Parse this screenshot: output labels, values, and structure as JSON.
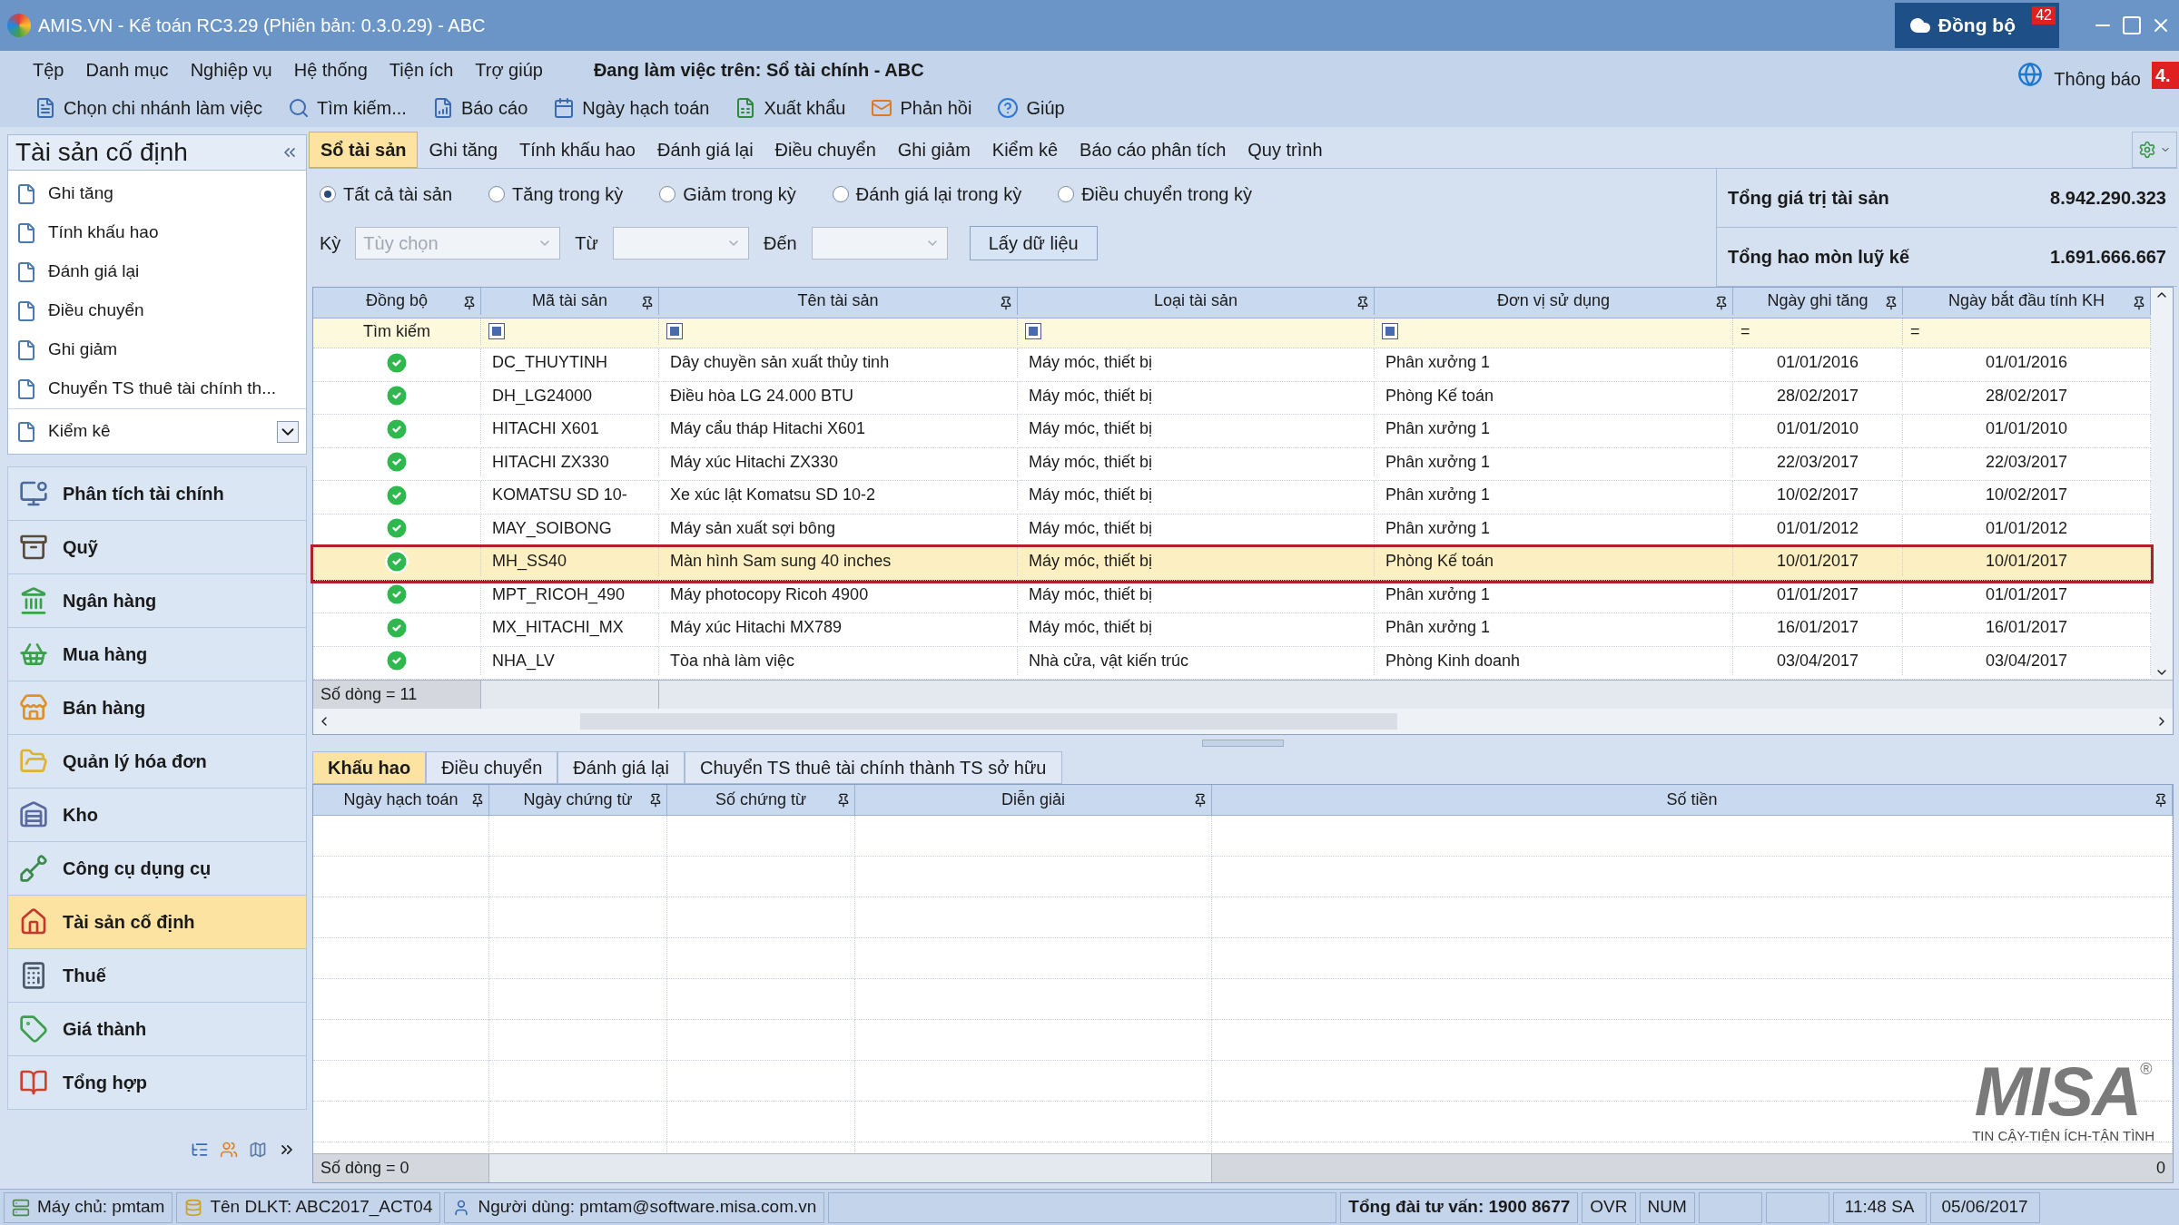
{
  "window": {
    "title": "AMIS.VN - Kế toán RC3.29 (Phiên bản: 0.3.0.29) - ABC",
    "sync_button": {
      "label": "Đồng bộ",
      "badge": "42"
    }
  },
  "menu": {
    "items": [
      "Tệp",
      "Danh mục",
      "Nghiệp vụ",
      "Hệ thống",
      "Tiện ích",
      "Trợ giúp"
    ],
    "working_on": "Đang làm việc trên: Sổ tài chính - ABC",
    "notification": {
      "label": "Thông báo",
      "badge": "4."
    }
  },
  "toolbar": [
    "Chọn chi nhánh làm việc",
    "Tìm kiếm...",
    "Báo cáo",
    "Ngày hạch toán",
    "Xuất khẩu",
    "Phản hồi",
    "Giúp"
  ],
  "sidebar": {
    "title": "Tài sản cố định",
    "items": [
      "Ghi tăng",
      "Tính khấu hao",
      "Đánh giá lại",
      "Điều chuyển",
      "Ghi giảm",
      "Chuyển TS thuê tài chính th..."
    ],
    "more_item": "Kiểm kê",
    "modules": [
      {
        "label": "Phân tích tài chính",
        "selected": false
      },
      {
        "label": "Quỹ",
        "selected": false
      },
      {
        "label": "Ngân hàng",
        "selected": false
      },
      {
        "label": "Mua hàng",
        "selected": false
      },
      {
        "label": "Bán hàng",
        "selected": false
      },
      {
        "label": "Quản lý hóa đơn",
        "selected": false
      },
      {
        "label": "Kho",
        "selected": false
      },
      {
        "label": "Công cụ dụng cụ",
        "selected": false
      },
      {
        "label": "Tài sản cố định",
        "selected": true
      },
      {
        "label": "Thuế",
        "selected": false
      },
      {
        "label": "Giá thành",
        "selected": false
      },
      {
        "label": "Tổng hợp",
        "selected": false
      }
    ]
  },
  "tabs": [
    {
      "label": "Sổ tài sản",
      "selected": true
    },
    {
      "label": "Ghi tăng",
      "selected": false
    },
    {
      "label": "Tính khấu hao",
      "selected": false
    },
    {
      "label": "Đánh giá lại",
      "selected": false
    },
    {
      "label": "Điều chuyển",
      "selected": false
    },
    {
      "label": "Ghi giảm",
      "selected": false
    },
    {
      "label": "Kiểm kê",
      "selected": false
    },
    {
      "label": "Báo cáo phân tích",
      "selected": false
    },
    {
      "label": "Quy trình",
      "selected": false
    }
  ],
  "filters": {
    "radios": [
      {
        "label": "Tất cả tài sản",
        "selected": true
      },
      {
        "label": "Tăng trong kỳ",
        "selected": false
      },
      {
        "label": "Giảm trong kỳ",
        "selected": false
      },
      {
        "label": "Đánh giá lại trong kỳ",
        "selected": false
      },
      {
        "label": "Điều chuyển trong kỳ",
        "selected": false
      }
    ],
    "period_label": "Kỳ",
    "period_value": "Tùy chọn",
    "from_label": "Từ",
    "to_label": "Đến",
    "fetch_button": "Lấy dữ liệu"
  },
  "summary": [
    {
      "label": "Tổng giá trị tài sản",
      "value": "8.942.290.323"
    },
    {
      "label": "Tổng hao mòn luỹ kế",
      "value": "1.691.666.667"
    }
  ],
  "asset_grid": {
    "columns": [
      {
        "label": "Đồng bộ",
        "kind": "status"
      },
      {
        "label": "Mã tài sản",
        "kind": "text"
      },
      {
        "label": "Tên tài sản",
        "kind": "text"
      },
      {
        "label": "Loại tài sản",
        "kind": "text"
      },
      {
        "label": "Đơn vị sử dụng",
        "kind": "text"
      },
      {
        "label": "Ngày ghi tăng",
        "kind": "date"
      },
      {
        "label": "Ngày bắt đầu tính KH",
        "kind": "date"
      }
    ],
    "filter_row": [
      {
        "kind": "text",
        "text": "Tìm kiếm"
      },
      {
        "kind": "icon"
      },
      {
        "kind": "icon"
      },
      {
        "kind": "icon"
      },
      {
        "kind": "icon"
      },
      {
        "kind": "text",
        "text": "="
      },
      {
        "kind": "text",
        "text": "="
      }
    ],
    "rows": [
      {
        "synced": true,
        "selected": false,
        "cells": [
          "",
          "DC_THUYTINH",
          "Dây chuyền sản xuất thủy tinh",
          "Máy móc, thiết bị",
          "Phân xưởng 1",
          "01/01/2016",
          "01/01/2016"
        ]
      },
      {
        "synced": true,
        "selected": false,
        "cells": [
          "",
          "DH_LG24000",
          "Điều hòa LG 24.000 BTU",
          "Máy móc, thiết bị",
          "Phòng Kế toán",
          "28/02/2017",
          "28/02/2017"
        ]
      },
      {
        "synced": true,
        "selected": false,
        "cells": [
          "",
          "HITACHI X601",
          "Máy cẩu tháp Hitachi X601",
          "Máy móc, thiết bị",
          "Phân xưởng 1",
          "01/01/2010",
          "01/01/2010"
        ]
      },
      {
        "synced": true,
        "selected": false,
        "cells": [
          "",
          "HITACHI ZX330",
          "Máy xúc Hitachi ZX330",
          "Máy móc, thiết bị",
          "Phân xưởng 1",
          "22/03/2017",
          "22/03/2017"
        ]
      },
      {
        "synced": true,
        "selected": false,
        "cells": [
          "",
          "KOMATSU SD 10-",
          "Xe xúc lật Komatsu SD 10-2",
          "Máy móc, thiết bị",
          "Phân xưởng 1",
          "10/02/2017",
          "10/02/2017"
        ]
      },
      {
        "synced": true,
        "selected": false,
        "cells": [
          "",
          "MAY_SOIBONG",
          "Máy sản xuất sợi bông",
          "Máy móc, thiết bị",
          "Phân xưởng 1",
          "01/01/2012",
          "01/01/2012"
        ]
      },
      {
        "synced": true,
        "selected": true,
        "cells": [
          "",
          "MH_SS40",
          "Màn hình Sam sung 40 inches",
          "Máy móc, thiết bị",
          "Phòng Kế toán",
          "10/01/2017",
          "10/01/2017"
        ]
      },
      {
        "synced": true,
        "selected": false,
        "cells": [
          "",
          "MPT_RICOH_490",
          "Máy photocopy Ricoh 4900",
          "Máy móc, thiết bị",
          "Phân xưởng 1",
          "01/01/2017",
          "01/01/2017"
        ]
      },
      {
        "synced": true,
        "selected": false,
        "cells": [
          "",
          "MX_HITACHI_MX",
          "Máy xúc Hitachi MX789",
          "Máy móc, thiết bị",
          "Phân xưởng 1",
          "16/01/2017",
          "16/01/2017"
        ]
      },
      {
        "synced": true,
        "selected": false,
        "cells": [
          "",
          "NHA_LV",
          "Tòa nhà làm việc",
          "Nhà cửa, vật kiến trúc",
          "Phòng Kinh doanh",
          "03/04/2017",
          "03/04/2017"
        ]
      }
    ],
    "footer": "Số dòng = 11"
  },
  "detail_tabs": [
    {
      "label": "Khấu hao",
      "selected": true
    },
    {
      "label": "Điều chuyển",
      "selected": false
    },
    {
      "label": "Đánh giá lại",
      "selected": false
    },
    {
      "label": "Chuyển TS thuê tài chính thành TS sở hữu",
      "selected": false
    }
  ],
  "detail_grid": {
    "columns": [
      "Ngày hạch toán",
      "Ngày chứng từ",
      "Số chứng từ",
      "Diễn giải",
      "Số tiền"
    ],
    "footer": "Số dòng = 0",
    "total": "0"
  },
  "logo": {
    "name": "MISA",
    "mark": "®",
    "tagline": "TIN CẬY-TIỆN ÍCH-TẬN TÌNH"
  },
  "status_bar": {
    "server": "Máy chủ: pmtam",
    "database": "Tên DLKT: ABC2017_ACT04",
    "user": "Người dùng: pmtam@software.misa.com.vn",
    "hotline": "Tổng đài tư vấn: 1900 8677",
    "indicators": [
      "OVR",
      "NUM"
    ],
    "time": "11:48 SA",
    "date": "05/06/2017"
  }
}
